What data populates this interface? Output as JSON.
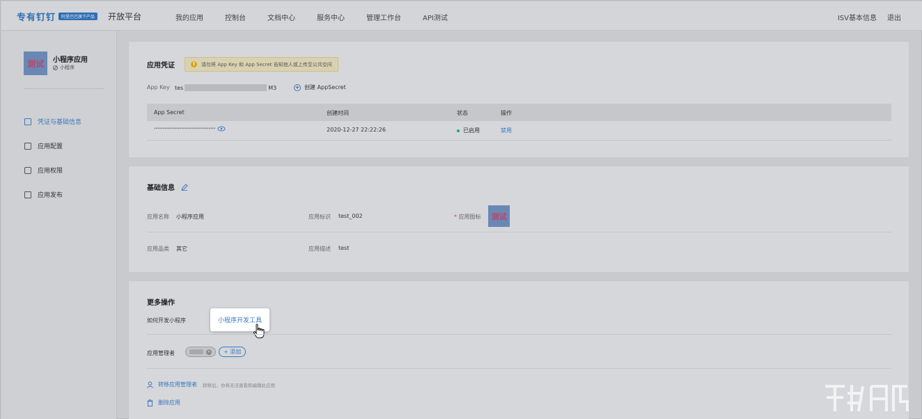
{
  "header": {
    "logo_text": "专有钉钉",
    "logo_badge": "阿里巴巴旗下产品",
    "platform_title": "开放平台",
    "nav": [
      "我的应用",
      "控制台",
      "文档中心",
      "服务中心",
      "管理工作台",
      "API测试"
    ],
    "right": [
      "ISV基本信息",
      "退出"
    ]
  },
  "sidebar": {
    "app_icon_text": "测试",
    "app_name": "小程序应用",
    "app_type": "小程序",
    "menu": [
      {
        "label": "凭证与基础信息",
        "icon": "credential-icon",
        "active": true
      },
      {
        "label": "应用配置",
        "icon": "config-icon",
        "active": false
      },
      {
        "label": "应用权限",
        "icon": "lock-icon",
        "active": false
      },
      {
        "label": "应用发布",
        "icon": "publish-icon",
        "active": false
      }
    ]
  },
  "credentials": {
    "title": "应用凭证",
    "warning": "请勿将 App Key 和 App Secret 告知他人或上传至公共空间",
    "app_key_label": "App Key",
    "app_key_prefix": "tes",
    "app_key_suffix": "M3",
    "create_secret": "创建 AppSecret",
    "table": {
      "headers": [
        "App Secret",
        "创建时间",
        "状态",
        "操作"
      ],
      "row": {
        "secret": "••••••••••••••••••••••••••••••••••••",
        "created": "2020-12-27 22:22:26",
        "status": "已启用",
        "action": "禁用"
      }
    }
  },
  "basic": {
    "title": "基础信息",
    "app_name_label": "应用名称",
    "app_name": "小程序应用",
    "app_id_label": "应用标识",
    "app_id": "test_002",
    "icon_label": "应用图标",
    "icon_text": "测试",
    "category_label": "应用品类",
    "category": "其它",
    "desc_label": "应用描述",
    "desc": "test"
  },
  "more": {
    "title": "更多操作",
    "how_to": "如何开发小程序",
    "dev_tool": "小程序开发工具",
    "admin_label": "应用管理者",
    "admin_chip": "张三",
    "add": "+ 添加",
    "transfer": "转移应用管理者",
    "transfer_hint": "转移后，你将无法查看和编辑此应用",
    "delete": "删除应用"
  },
  "colors": {
    "accent": "#3a78c0",
    "status_green": "#2aa56a",
    "warning_bg": "#d9d2b1"
  }
}
